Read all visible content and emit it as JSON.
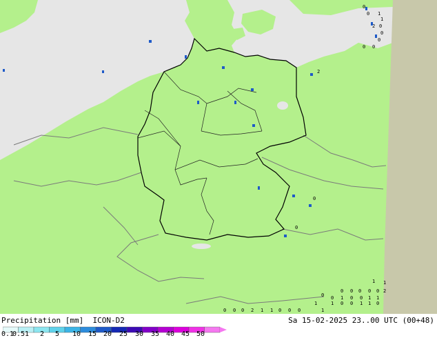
{
  "map": {
    "product": "Precipitation [mm]",
    "model": "ICON-D2",
    "valid_time": "Sa 15-02-2025 23..00 UTC (00+48)",
    "colors": {
      "land": "#b4f08c",
      "sea": "#e6e6e6",
      "outside_domain": "#c8c8aa",
      "borders": "#000000",
      "border_others": "#7a7a7a"
    }
  },
  "legend": {
    "ticks": [
      "0.1",
      "0.5",
      "1",
      "2",
      "5",
      "10",
      "15",
      "20",
      "25",
      "30",
      "35",
      "40",
      "45",
      "50"
    ],
    "colors": [
      "#e6fafa",
      "#b9f0f5",
      "#8ce6f0",
      "#5fd2eb",
      "#3cb4e6",
      "#2d8cdc",
      "#1e5ac8",
      "#1428b4",
      "#3c0ab4",
      "#8200c8",
      "#b400d2",
      "#dc00dc",
      "#f032e6",
      "#f578f0"
    ]
  },
  "point_values": [
    "0",
    "0",
    "0",
    "2",
    "1",
    "1",
    "0",
    "0",
    "0",
    "1",
    "0",
    "0",
    "1",
    "1",
    "0",
    "0",
    "1",
    "0",
    "0",
    "1",
    "1",
    "0",
    "0",
    "0",
    "0",
    "0",
    "1",
    "1",
    "0",
    "0",
    "0",
    "0",
    "0",
    "2",
    "1",
    "1",
    "0",
    "0",
    "0",
    "0",
    "2",
    "2",
    "1",
    "1",
    "0"
  ]
}
